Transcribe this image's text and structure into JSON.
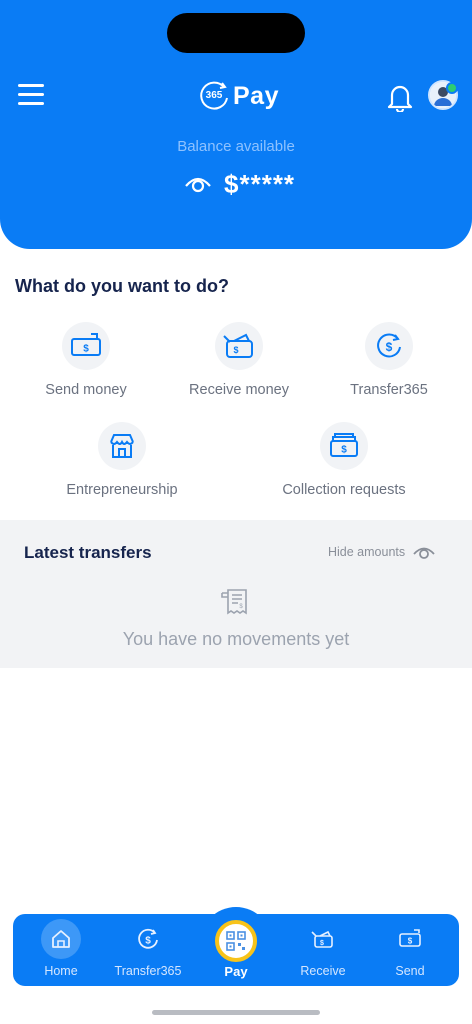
{
  "header": {
    "logo_number": "365",
    "logo_word": "Pay",
    "balance_label": "Balance available",
    "balance_value": "$*****"
  },
  "actions": {
    "title": "What do you want to do?",
    "items": [
      {
        "label": "Send money",
        "icon": "send-money-icon"
      },
      {
        "label": "Receive money",
        "icon": "receive-money-icon"
      },
      {
        "label": "Transfer365",
        "icon": "transfer-icon"
      },
      {
        "label": "Entrepreneurship",
        "icon": "store-icon"
      },
      {
        "label": "Collection requests",
        "icon": "collection-icon"
      }
    ]
  },
  "transfers": {
    "title": "Latest transfers",
    "hide_label": "Hide amounts",
    "empty_text": "You have no movements yet"
  },
  "tabbar": {
    "items": [
      {
        "label": "Home",
        "active": true
      },
      {
        "label": "Transfer365"
      },
      {
        "label": "Pay"
      },
      {
        "label": "Receive"
      },
      {
        "label": "Send"
      }
    ]
  },
  "colors": {
    "primary": "#0a7cf5",
    "heading": "#16244d",
    "pay_ring": "#f7c31a",
    "success": "#2ecc71"
  }
}
